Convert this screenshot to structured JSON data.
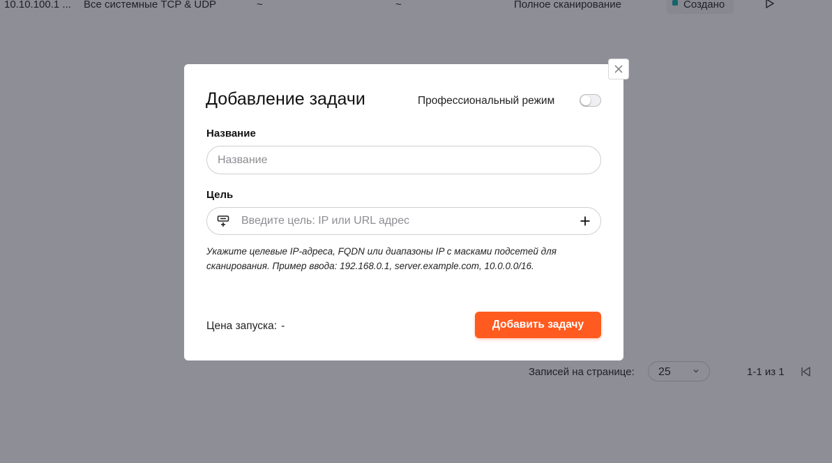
{
  "background_table": {
    "row": {
      "target": "10.10.100.1 ...",
      "ports": "Все системные TCP & UDP",
      "col3": "~",
      "col4": "~",
      "scan_type": "Полное сканирование",
      "status": "Создано",
      "status_color": "#1aa6a6",
      "action_icon": "play-icon"
    }
  },
  "pagination": {
    "per_page_label": "Записей на странице:",
    "per_page_value": "25",
    "range_text": "1-1 из 1",
    "first_page_icon": "first-page-icon"
  },
  "modal": {
    "title": "Добавление задачи",
    "pro_mode_label": "Профессиональный режим",
    "pro_mode_enabled": false,
    "name_label": "Название",
    "name_placeholder": "Название",
    "name_value": "",
    "target_label": "Цель",
    "target_placeholder": "Введите цель: IP или URL адрес",
    "target_value": "",
    "target_icon": "target-list-icon",
    "add_target_icon": "plus-icon",
    "hint": "Укажите целевые IP-адреса, FQDN или диапазоны IP с масками подсетей для сканирования. Пример ввода: 192.168.0.1, server.example.com, 10.0.0.0/16.",
    "price_label": "Цена запуска:",
    "price_value": "-",
    "submit_label": "Добавить задачу",
    "close_icon": "close-icon"
  },
  "colors": {
    "accent": "#ff5a1f",
    "overlay": "rgba(20,20,35,0.45)"
  }
}
